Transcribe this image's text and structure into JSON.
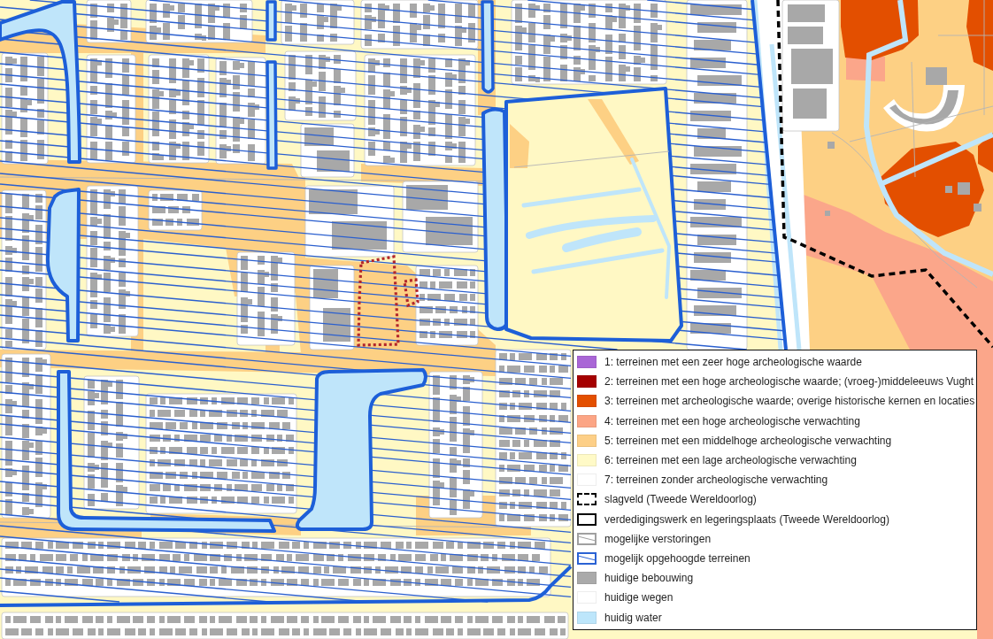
{
  "legend": {
    "items": [
      {
        "label": "1: terreinen met een zeer hoge archeologische waarde",
        "kind": "fill",
        "color": "#a966d6"
      },
      {
        "label": "2: terreinen met een hoge archeologische waarde; (vroeg-)middeleeuws Vught",
        "kind": "fill",
        "color": "#a50000"
      },
      {
        "label": "3: terreinen met archeologische waarde; overige historische kernen en locaties",
        "kind": "fill",
        "color": "#e34f00"
      },
      {
        "label": "4: terreinen met een hoge archeologische verwachting",
        "kind": "fill",
        "color": "#fca585"
      },
      {
        "label": "5: terreinen met een middelhoge archeologische verwachting",
        "kind": "fill",
        "color": "#fdcf87"
      },
      {
        "label": "6: terreinen met een lage archeologische verwachting",
        "kind": "fill",
        "color": "#fffac7"
      },
      {
        "label": "7: terreinen zonder archeologische verwachting",
        "kind": "fill",
        "color": "#ffffff"
      },
      {
        "label": "slagveld (Tweede Wereldoorlog)",
        "kind": "dashed-outline",
        "color": "#000000"
      },
      {
        "label": "verdedigingswerk en legeringsplaats (Tweede Wereldoorlog)",
        "kind": "outline",
        "color": "#000000"
      },
      {
        "label": "mogelijke verstoringen",
        "kind": "hatch",
        "color": "#a0a0a0"
      },
      {
        "label": "mogelijk opgehoogde terreinen",
        "kind": "hatch",
        "color": "#2a62d4"
      },
      {
        "label": "huidige bebouwing",
        "kind": "fill",
        "color": "#aaaaaa"
      },
      {
        "label": "huidige wegen",
        "kind": "fill",
        "color": "#ffffff"
      },
      {
        "label": "huidig water",
        "kind": "fill",
        "color": "#bde6fb"
      }
    ]
  }
}
